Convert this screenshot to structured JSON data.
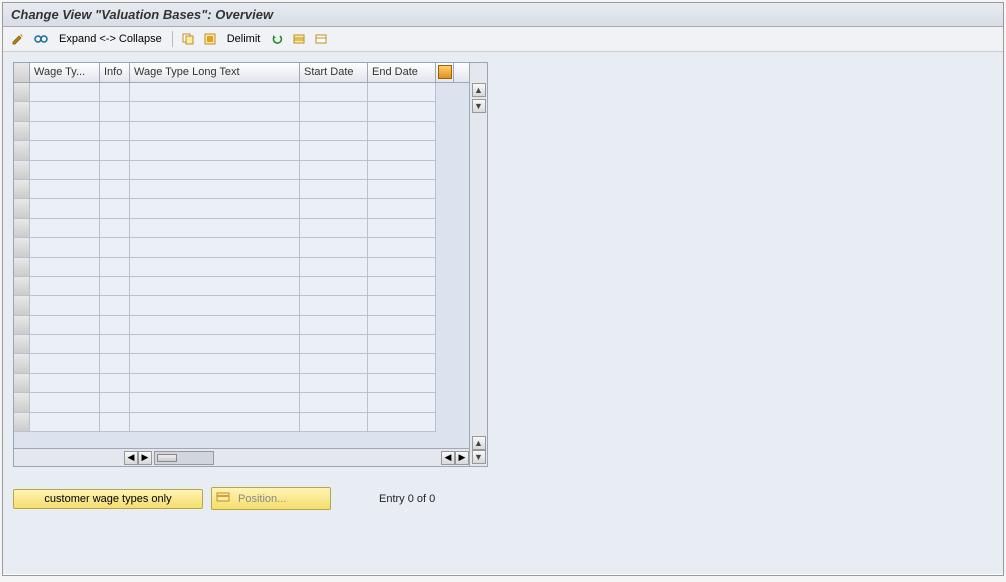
{
  "title": "Change View \"Valuation Bases\": Overview",
  "toolbar": {
    "expand_collapse_label": "Expand <-> Collapse",
    "delimit_label": "Delimit"
  },
  "table": {
    "columns": {
      "wage_type": "Wage Ty...",
      "info": "Info",
      "long_text": "Wage Type Long Text",
      "start_date": "Start Date",
      "end_date": "End Date"
    },
    "rows": []
  },
  "buttons": {
    "customer_wage_types": "customer wage types only",
    "position": "Position..."
  },
  "status": {
    "entry_text": "Entry 0 of 0"
  },
  "icons": {
    "pencil": "pencil-icon",
    "glasses": "glasses-icon",
    "copy": "copy-icon",
    "select_all": "select-all-icon",
    "undo": "undo-icon",
    "print": "print-icon",
    "table_cfg": "table-config-icon",
    "row": "row-icon"
  }
}
